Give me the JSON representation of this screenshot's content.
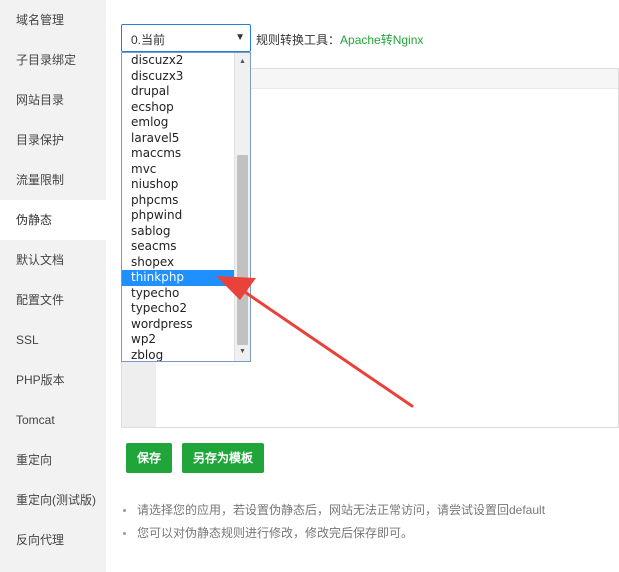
{
  "sidebar": {
    "items": [
      {
        "label": "域名管理"
      },
      {
        "label": "子目录绑定"
      },
      {
        "label": "网站目录"
      },
      {
        "label": "目录保护"
      },
      {
        "label": "流量限制"
      },
      {
        "label": "伪静态"
      },
      {
        "label": "默认文档"
      },
      {
        "label": "配置文件"
      },
      {
        "label": "SSL"
      },
      {
        "label": "PHP版本"
      },
      {
        "label": "Tomcat"
      },
      {
        "label": "重定向"
      },
      {
        "label": "重定向(测试版)"
      },
      {
        "label": "反向代理"
      }
    ],
    "active_index": 5
  },
  "toolbar": {
    "select_value": "0.当前",
    "tool_label": "规则转换工具：",
    "tool_link": "Apache转Nginx"
  },
  "dropdown": {
    "options": [
      "discuzx2",
      "discuzx3",
      "drupal",
      "ecshop",
      "emlog",
      "laravel5",
      "maccms",
      "mvc",
      "niushop",
      "phpcms",
      "phpwind",
      "sablog",
      "seacms",
      "shopex",
      "thinkphp",
      "typecho",
      "typecho2",
      "wordpress",
      "wp2",
      "zblog"
    ],
    "selected": "thinkphp"
  },
  "buttons": {
    "save": "保存",
    "save_as_template": "另存为模板"
  },
  "tips": [
    "请选择您的应用，若设置伪静态后，网站无法正常访问，请尝试设置回default",
    "您可以对伪静态规则进行修改，修改完后保存即可。"
  ],
  "colors": {
    "accent_green": "#20a53a",
    "selection_blue": "#1e90ff",
    "annotation_red": "#e8423a"
  },
  "icons": {
    "select_arrow": "caret-down-icon",
    "scroll_up": "triangle-up-icon",
    "scroll_down": "triangle-down-icon"
  }
}
